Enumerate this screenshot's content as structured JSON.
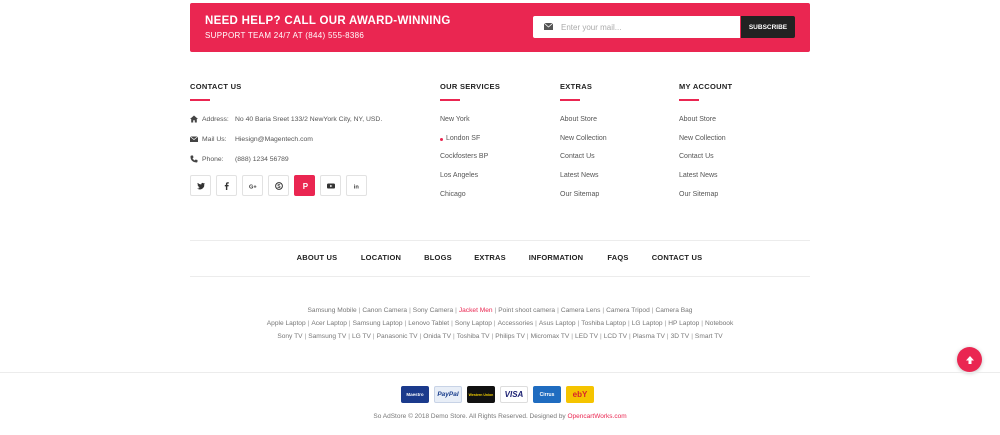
{
  "newsletter": {
    "title": "NEED HELP? CALL OUR AWARD-WINNING",
    "subtitle": "SUPPORT TEAM 24/7 AT (844) 555-8386",
    "placeholder": "Enter your mail...",
    "button": "SUBSCRIBE"
  },
  "contact": {
    "title": "CONTACT US",
    "address_label": "Address:",
    "address": "No 40 Baria Sreet 133/2 NewYork City, NY, USD.",
    "mail_label": "Mail Us:",
    "mail": "Hiesign@Magentech.com",
    "phone_label": "Phone:",
    "phone": "(888) 1234 56789",
    "social": [
      "twitter-icon",
      "facebook-icon",
      "google-plus-icon",
      "skype-icon",
      "pinterest-icon",
      "youtube-icon",
      "linkedin-icon"
    ]
  },
  "services": {
    "title": "OUR SERVICES",
    "items": [
      "New York",
      "London SF",
      "Cockfosters BP",
      "Los Angeles",
      "Chicago"
    ]
  },
  "extras": {
    "title": "EXTRAS",
    "items": [
      "About Store",
      "New Collection",
      "Contact Us",
      "Latest News",
      "Our Sitemap"
    ]
  },
  "account": {
    "title": "MY ACCOUNT",
    "items": [
      "About Store",
      "New Collection",
      "Contact Us",
      "Latest News",
      "Our Sitemap"
    ]
  },
  "nav": [
    "ABOUT US",
    "LOCATION",
    "BLOGS",
    "EXTRAS",
    "INFORMATION",
    "FAQS",
    "CONTACT US"
  ],
  "tags": {
    "row1": [
      "Samsung Mobile",
      "Canon Camera",
      "Sony Camera",
      "Jacket Men",
      "Point shoot camera",
      "Camera Lens",
      "Camera Tripod",
      "Camera Bag"
    ],
    "row2": [
      "Apple Laptop",
      "Acer Laptop",
      "Samsung Laptop",
      "Lenovo Tablet",
      "Sony Laptop",
      "Accessories",
      "Asus Laptop",
      "Toshiba Laptop",
      "LG Laptop",
      "HP Laptop",
      "Notebook"
    ],
    "row3": [
      "Sony TV",
      "Samsung TV",
      "LG TV",
      "Panasonic TV",
      "Onida TV",
      "Toshiba TV",
      "Philips TV",
      "Micromax TV",
      "LED TV",
      "LCD TV",
      "Plasma TV",
      "3D TV",
      "Smart TV"
    ],
    "highlight": "Jacket Men"
  },
  "payments": [
    "Maestro",
    "PayPal",
    "Western Union",
    "VISA",
    "Cirrus",
    "ebY"
  ],
  "copyright": {
    "text": "So AdStore © 2018 Demo Store. All Rights Reserved. Designed by ",
    "brand": "OpencartWorks.com"
  },
  "colors": {
    "accent": "#ea2651",
    "dark": "#222222"
  }
}
